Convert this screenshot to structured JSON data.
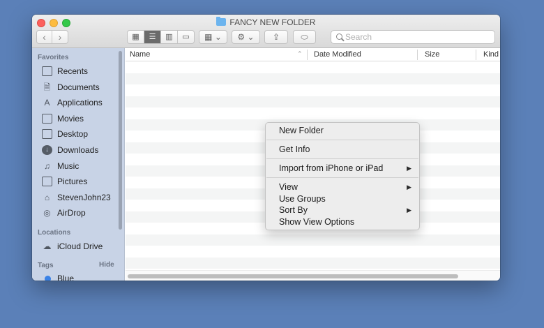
{
  "window": {
    "title": "FANCY NEW FOLDER"
  },
  "toolbar": {
    "back_label": "‹",
    "forward_label": "›",
    "view_modes": [
      "icons",
      "list",
      "columns",
      "gallery"
    ],
    "active_view": "list",
    "search_placeholder": "Search"
  },
  "sidebar": {
    "favorites_header": "Favorites",
    "favorites": [
      {
        "label": "Recents",
        "icon": "recents-icon"
      },
      {
        "label": "Documents",
        "icon": "documents-icon"
      },
      {
        "label": "Applications",
        "icon": "applications-icon"
      },
      {
        "label": "Movies",
        "icon": "movies-icon"
      },
      {
        "label": "Desktop",
        "icon": "desktop-icon"
      },
      {
        "label": "Downloads",
        "icon": "downloads-icon"
      },
      {
        "label": "Music",
        "icon": "music-icon"
      },
      {
        "label": "Pictures",
        "icon": "pictures-icon"
      },
      {
        "label": "StevenJohn23",
        "icon": "home-icon"
      },
      {
        "label": "AirDrop",
        "icon": "airdrop-icon"
      }
    ],
    "locations_header": "Locations",
    "locations": [
      {
        "label": "iCloud Drive",
        "icon": "cloud-icon"
      }
    ],
    "tags_header": "Tags",
    "tags_hide_label": "Hide",
    "tags": [
      {
        "label": "Blue",
        "color": "#3a82e6"
      }
    ]
  },
  "list": {
    "columns": [
      "Name",
      "Date Modified",
      "Size",
      "Kind"
    ],
    "sorted_column": "Name",
    "sort_direction": "ascending"
  },
  "context_menu": {
    "items": [
      {
        "label": "New Folder",
        "submenu": false
      },
      {
        "label": "Get Info",
        "submenu": false
      },
      {
        "label": "Import from iPhone or iPad",
        "submenu": true
      },
      {
        "label": "View",
        "submenu": true
      },
      {
        "label": "Use Groups",
        "submenu": false
      },
      {
        "label": "Sort By",
        "submenu": true
      },
      {
        "label": "Show View Options",
        "submenu": false
      }
    ],
    "submenu_arrow": "▶"
  },
  "colors": {
    "desktop": "#5b80b8",
    "sidebar": "#c8d3e6",
    "close": "#fc605c",
    "minimize": "#fdbc40",
    "maximize": "#34c84a",
    "folder": "#6cb4ee"
  }
}
